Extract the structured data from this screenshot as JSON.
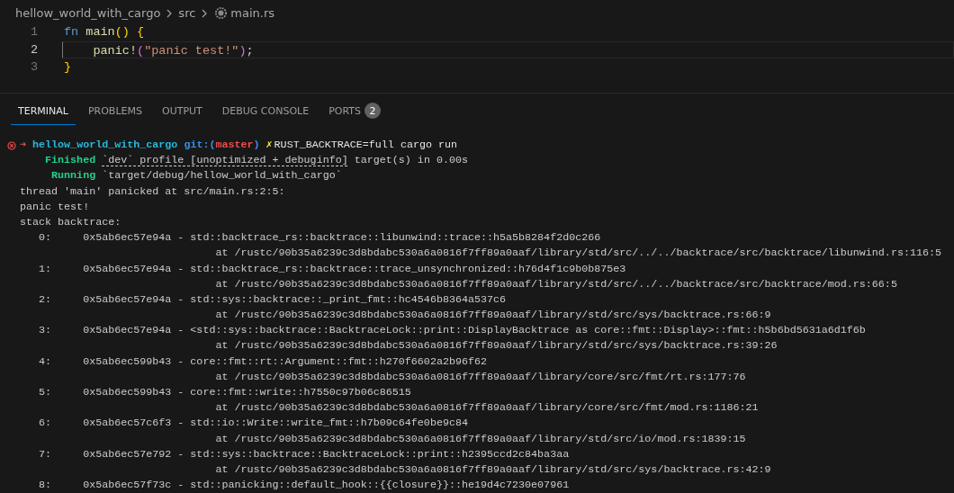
{
  "breadcrumb": [
    {
      "label": "hellow_world_with_cargo",
      "kind": "folder"
    },
    {
      "label": "src",
      "kind": "folder"
    },
    {
      "label": "main.rs",
      "kind": "file"
    }
  ],
  "editor": {
    "lines": [
      {
        "number": "1",
        "current": false,
        "tokens": [
          {
            "text": "fn",
            "kind": "keyword"
          },
          {
            "text": " main",
            "kind": "function"
          },
          {
            "text": "()",
            "kind": "bracket"
          },
          {
            "text": " {",
            "kind": "bracket"
          }
        ]
      },
      {
        "number": "2",
        "current": true,
        "tokens": [
          {
            "text": "    panic!",
            "kind": "function"
          },
          {
            "text": "(",
            "kind": "bracket2"
          },
          {
            "text": "\"panic test!\"",
            "kind": "string"
          },
          {
            "text": ")",
            "kind": "bracket2"
          },
          {
            "text": ";"
          }
        ]
      },
      {
        "number": "3",
        "current": false,
        "tokens": [
          {
            "text": "}",
            "kind": "bracket"
          }
        ]
      }
    ]
  },
  "panel": {
    "tabs": [
      {
        "label": "TERMINAL",
        "selected": true
      },
      {
        "label": "PROBLEMS",
        "selected": false
      },
      {
        "label": "OUTPUT",
        "selected": false
      },
      {
        "label": "DEBUG CONSOLE",
        "selected": false
      },
      {
        "label": "PORTS",
        "selected": false,
        "badge": "2"
      }
    ]
  },
  "terminal": {
    "lines": [
      {
        "kind": "prompt",
        "failed": true,
        "arrow": "➜",
        "directory": "hellow_world_with_cargo",
        "git_open": "git:(",
        "branch": "master",
        "git_close": ")",
        "dirty": "✗",
        "command": "RUST_BACKTRACE=full cargo run"
      },
      {
        "kind": "status",
        "label": "    Finished",
        "underlined": "`dev` profile [unoptimized + debuginfo]",
        "text": " target(s) in 0.00s"
      },
      {
        "kind": "status",
        "label": "     Running",
        "text": " `target/debug/hellow_world_with_cargo`"
      },
      {
        "kind": "plain",
        "text": "thread 'main' panicked at src/main.rs:2:5:"
      },
      {
        "kind": "plain",
        "text": "panic test!"
      },
      {
        "kind": "plain",
        "text": "stack backtrace:"
      }
    ],
    "frames": [
      {
        "index": "0:",
        "symbol": "0x5ab6ec57e94a - std::backtrace_rs::backtrace::libunwind::trace::h5a5b8284f2d0c266",
        "location": "at /rustc/90b35a6239c3d8bdabc530a6a0816f7ff89a0aaf/library/std/src/../../backtrace/src/backtrace/libunwind.rs:116:5"
      },
      {
        "index": "1:",
        "symbol": "0x5ab6ec57e94a - std::backtrace_rs::backtrace::trace_unsynchronized::h76d4f1c9b0b875e3",
        "location": "at /rustc/90b35a6239c3d8bdabc530a6a0816f7ff89a0aaf/library/std/src/../../backtrace/src/backtrace/mod.rs:66:5"
      },
      {
        "index": "2:",
        "symbol": "0x5ab6ec57e94a - std::sys::backtrace::_print_fmt::hc4546b8364a537c6",
        "location": "at /rustc/90b35a6239c3d8bdabc530a6a0816f7ff89a0aaf/library/std/src/sys/backtrace.rs:66:9"
      },
      {
        "index": "3:",
        "symbol": "0x5ab6ec57e94a - <std::sys::backtrace::BacktraceLock::print::DisplayBacktrace as core::fmt::Display>::fmt::h5b6bd5631a6d1f6b",
        "location": "at /rustc/90b35a6239c3d8bdabc530a6a0816f7ff89a0aaf/library/std/src/sys/backtrace.rs:39:26"
      },
      {
        "index": "4:",
        "symbol": "0x5ab6ec599b43 - core::fmt::rt::Argument::fmt::h270f6602a2b96f62",
        "location": "at /rustc/90b35a6239c3d8bdabc530a6a0816f7ff89a0aaf/library/core/src/fmt/rt.rs:177:76"
      },
      {
        "index": "5:",
        "symbol": "0x5ab6ec599b43 - core::fmt::write::h7550c97b06c86515",
        "location": "at /rustc/90b35a6239c3d8bdabc530a6a0816f7ff89a0aaf/library/core/src/fmt/mod.rs:1186:21"
      },
      {
        "index": "6:",
        "symbol": "0x5ab6ec57c6f3 - std::io::Write::write_fmt::h7b09c64fe0be9c84",
        "location": "at /rustc/90b35a6239c3d8bdabc530a6a0816f7ff89a0aaf/library/std/src/io/mod.rs:1839:15"
      },
      {
        "index": "7:",
        "symbol": "0x5ab6ec57e792 - std::sys::backtrace::BacktraceLock::print::h2395ccd2c84ba3aa",
        "location": "at /rustc/90b35a6239c3d8bdabc530a6a0816f7ff89a0aaf/library/std/src/sys/backtrace.rs:42:9"
      },
      {
        "index": "8:",
        "symbol": "0x5ab6ec57f73c - std::panicking::default_hook::{{closure}}::he19d4c7230e07961"
      }
    ]
  }
}
